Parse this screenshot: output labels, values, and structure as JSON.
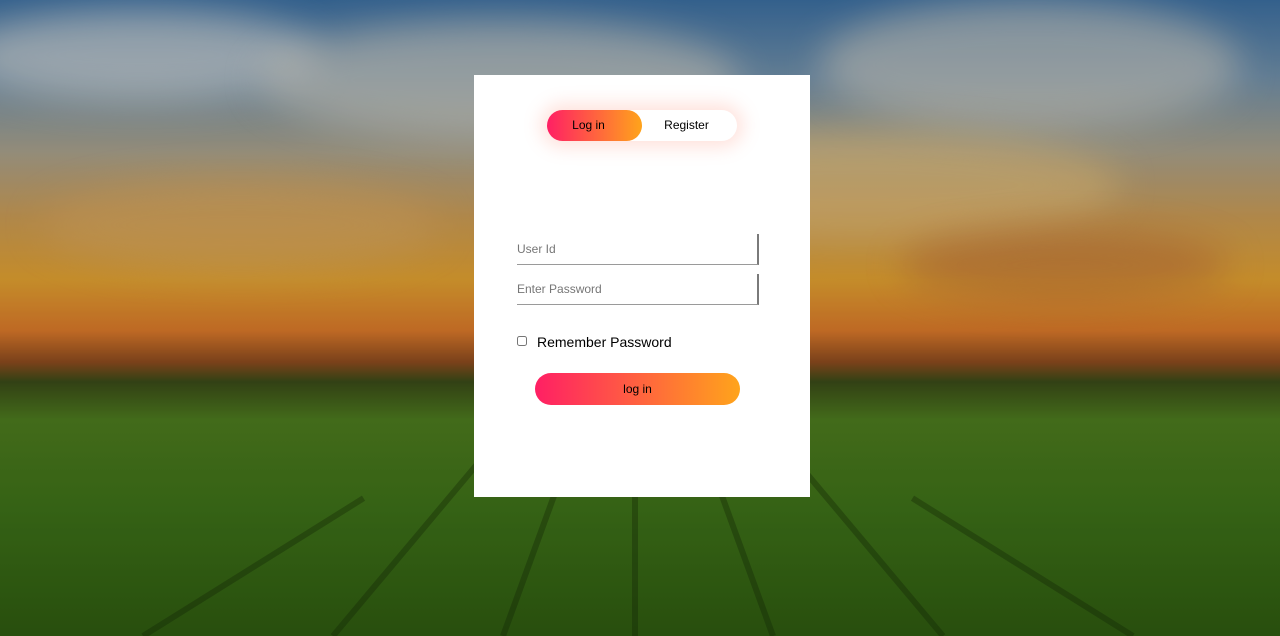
{
  "tabs": {
    "login_label": "Log in",
    "register_label": "Register"
  },
  "form": {
    "userid_placeholder": "User Id",
    "password_placeholder": "Enter Password",
    "remember_label": "Remember Password",
    "submit_label": "log in"
  },
  "colors": {
    "gradient_start": "#ff1f64",
    "gradient_end": "#ffa41b",
    "card_background": "#ffffff"
  }
}
